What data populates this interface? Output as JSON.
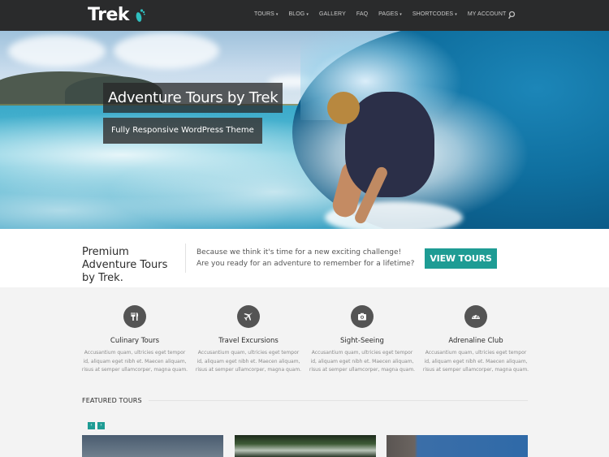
{
  "header": {
    "logo_text": "Trek",
    "logo_icon": "footprint-icon",
    "nav": [
      {
        "label": "TOURS",
        "has_dropdown": true
      },
      {
        "label": "BLOG",
        "has_dropdown": true
      },
      {
        "label": "GALLERY",
        "has_dropdown": false
      },
      {
        "label": "FAQ",
        "has_dropdown": false
      },
      {
        "label": "PAGES",
        "has_dropdown": true
      },
      {
        "label": "SHORTCODES",
        "has_dropdown": true
      },
      {
        "label": "MY ACCOUNT",
        "has_dropdown": false
      }
    ],
    "caret": "▾",
    "search_icon": "search-icon"
  },
  "hero": {
    "title": "Adventure Tours by Trek",
    "subtitle": "Fully Responsive WordPress Theme"
  },
  "cta": {
    "title": "Premium Adventure Tours by Trek.",
    "text": "Because we think it's time for a new exciting challenge! Are you ready for an adventure to remember for a lifetime?",
    "button_label": "VIEW TOURS"
  },
  "features": [
    {
      "icon": "cutlery-icon",
      "title": "Culinary Tours",
      "text": "Accusantium quam, ultricies eget tempor id, aliquam eget nibh et. Maecen aliquam, risus at semper ullamcorper, magna quam."
    },
    {
      "icon": "plane-icon",
      "title": "Travel Excursions",
      "text": "Accusantium quam, ultricies eget tempor id, aliquam eget nibh et. Maecen aliquam, risus at semper ullamcorper, magna quam."
    },
    {
      "icon": "camera-icon",
      "title": "Sight-Seeing",
      "text": "Accusantium quam, ultricies eget tempor id, aliquam eget nibh et. Maecen aliquam, risus at semper ullamcorper, magna quam."
    },
    {
      "icon": "speedometer-icon",
      "title": "Adrenaline Club",
      "text": "Accusantium quam, ultricies eget tempor id, aliquam eget nibh et. Maecen aliquam, risus at semper ullamcorper, magna quam."
    }
  ],
  "featured_tours": {
    "heading": "FEATURED TOURS",
    "prev_label": "‹",
    "next_label": "›"
  },
  "colors": {
    "accent": "#1e9c94",
    "header_bg": "#2a2b2c",
    "icon_circle": "#545454"
  }
}
